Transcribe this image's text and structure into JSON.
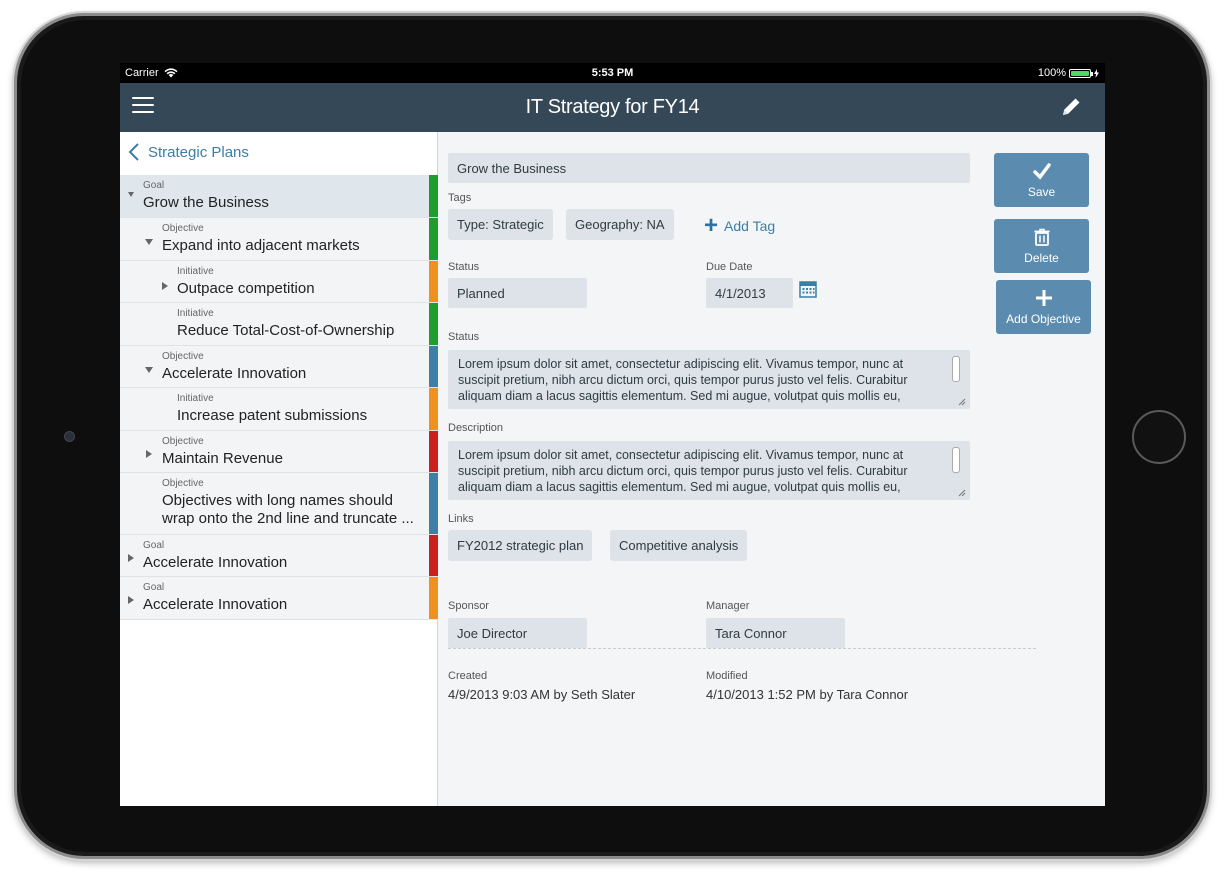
{
  "status_bar": {
    "carrier": "Carrier",
    "time": "5:53 PM",
    "battery": "100%"
  },
  "nav": {
    "title": "IT Strategy for FY14"
  },
  "left_panel": {
    "back_label": "Strategic Plans",
    "rows": [
      {
        "kind": "Goal",
        "name": "Grow the Business"
      },
      {
        "kind": "Objective",
        "name": "Expand into adjacent markets"
      },
      {
        "kind": "Initiative",
        "name": "Outpace competition"
      },
      {
        "kind": "Initiative",
        "name": "Reduce Total-Cost-of-Ownership"
      },
      {
        "kind": "Objective",
        "name": "Accelerate Innovation"
      },
      {
        "kind": "Initiative",
        "name": "Increase patent submissions"
      },
      {
        "kind": "Objective",
        "name": "Maintain Revenue"
      },
      {
        "kind": "Objective",
        "name": "Objectives with long names should wrap onto the 2nd line and truncate ..."
      },
      {
        "kind": "Goal",
        "name": "Accelerate Innovation"
      },
      {
        "kind": "Goal",
        "name": "Accelerate Innovation"
      }
    ]
  },
  "detail": {
    "title_value": "Grow the Business",
    "tags_label": "Tags",
    "tags": [
      "Type: Strategic",
      "Geography: NA"
    ],
    "add_tag_label": "Add Tag",
    "status_label": "Status",
    "status_value": "Planned",
    "due_date_label": "Due Date",
    "due_date_value": "4/1/2013",
    "status_text_label": "Status",
    "status_text": "Lorem ipsum dolor sit amet, consectetur adipiscing elit. Vivamus tempor, nunc at suscipit pretium, nibh arcu dictum orci, quis tempor purus justo vel felis. Curabitur aliquam diam a lacus sagittis elementum. Sed mi augue, volutpat quis mollis eu,",
    "description_label": "Description",
    "description_text": "Lorem ipsum dolor sit amet, consectetur adipiscing elit. Vivamus tempor, nunc at suscipit pretium, nibh arcu dictum orci, quis tempor purus justo vel felis. Curabitur aliquam diam a lacus sagittis elementum. Sed mi augue, volutpat quis mollis eu,",
    "links_label": "Links",
    "links": [
      "FY2012 strategic plan",
      "Competitive analysis"
    ],
    "sponsor_label": "Sponsor",
    "sponsor_value": "Joe Director",
    "manager_label": "Manager",
    "manager_value": "Tara Connor",
    "created_label": "Created",
    "created_value": "4/9/2013 9:03 AM by Seth Slater",
    "modified_label": "Modified",
    "modified_value": "4/10/2013 1:52 PM by Tara Connor"
  },
  "actions": {
    "save_label": "Save",
    "delete_label": "Delete",
    "add_objective_label": "Add Objective"
  },
  "colors": {
    "nav_bg": "#344857",
    "accent": "#3b7ea6",
    "button_bg": "#5b8cb0",
    "green": "#1f9d2e",
    "orange": "#f0901e",
    "blue": "#3d7fa6",
    "red": "#cc1f1f"
  }
}
